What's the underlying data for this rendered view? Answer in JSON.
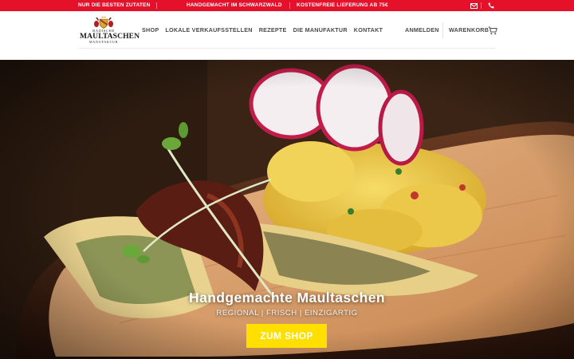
{
  "topbar": {
    "items": [
      "NUR DIE BESTEN ZUTATEN",
      "HANDGEMACHT IM SCHWARZWALD",
      "KOSTENFREIE LIEFERUNG AB 75€"
    ],
    "icons": [
      "mail-icon",
      "phone-icon"
    ],
    "color": "#e5112b"
  },
  "logo": {
    "line1": "BADISCHE",
    "line2": "MAULTASCHEN",
    "line3": "MANUFAKTUR"
  },
  "nav": {
    "items": [
      "SHOP",
      "LOKALE VERKAUFSSTELLEN",
      "REZEPTE",
      "DIE MANUFAKTUR",
      "KONTAKT"
    ]
  },
  "header_right": {
    "login": "ANMELDEN",
    "cart": "WARENKORB",
    "cart_icon": "cart-icon"
  },
  "hero": {
    "title": "Handgemachte Maultaschen",
    "subtitle": "REGIONAL | FRISCH | EINZIGARTIG",
    "button": "ZUM SHOP",
    "button_color": "#ffdf00"
  }
}
